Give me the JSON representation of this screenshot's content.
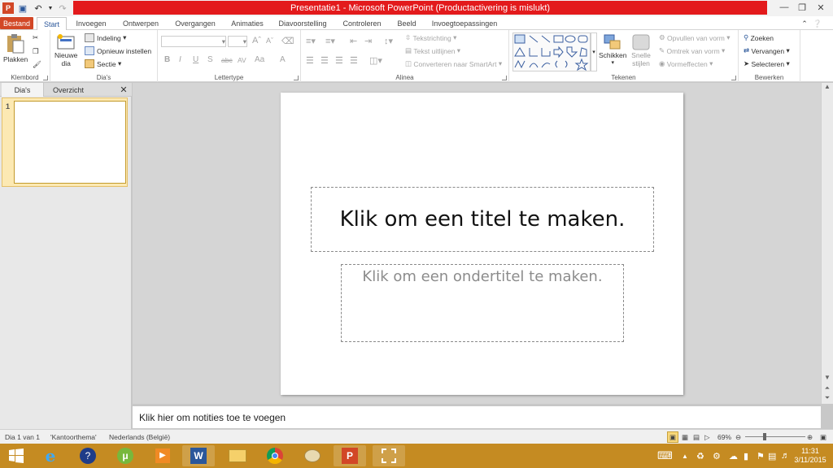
{
  "window": {
    "title": "Presentatie1 - Microsoft PowerPoint (Productactivering is mislukt)"
  },
  "tabs": [
    "Bestand",
    "Start",
    "Invoegen",
    "Ontwerpen",
    "Overgangen",
    "Animaties",
    "Diavoorstelling",
    "Controleren",
    "Beeld",
    "Invoegtoepassingen"
  ],
  "ribbon": {
    "klembord": {
      "label": "Klembord",
      "paste": "Plakken"
    },
    "dias": {
      "label": "Dia's",
      "new_slide": "Nieuwe",
      "new_slide2": "dia",
      "layout": "Indeling",
      "reset": "Opnieuw instellen",
      "section": "Sectie"
    },
    "lettertype": {
      "label": "Lettertype",
      "bold": "B",
      "italic": "I",
      "underline": "U",
      "strike": "S",
      "abc": "abc",
      "av": "AV",
      "aa": "Aa",
      "a": "A"
    },
    "alinea": {
      "label": "Alinea",
      "text_direction": "Tekstrichting",
      "align_text": "Tekst uitlijnen",
      "smartart": "Converteren naar SmartArt"
    },
    "tekenen": {
      "label": "Tekenen",
      "arrange": "Schikken",
      "quick_styles": "Snelle",
      "quick_styles2": "stijlen",
      "fill": "Opvullen van vorm",
      "outline": "Omtrek van vorm",
      "effects": "Vormeffecten"
    },
    "bewerken": {
      "label": "Bewerken",
      "find": "Zoeken",
      "replace": "Vervangen",
      "select": "Selecteren"
    }
  },
  "leftpanel": {
    "tab_slides": "Dia's",
    "tab_outline": "Overzicht",
    "slide_number": "1"
  },
  "slide": {
    "title_placeholder": "Klik om een titel te maken.",
    "subtitle_placeholder": "Klik om een ondertitel te maken."
  },
  "notes": {
    "placeholder": "Klik hier om notities toe te voegen"
  },
  "statusbar": {
    "slide_count": "Dia 1 van 1",
    "theme": "'Kantoorthema'",
    "language": "Nederlands (België)",
    "zoom": "69%"
  },
  "taskbar": {
    "time": "11:31",
    "date": "3/11/2015"
  },
  "colors": {
    "file_tab": "#d24726",
    "activation_bar": "#e31a1c",
    "taskbar": "#c58b22"
  }
}
